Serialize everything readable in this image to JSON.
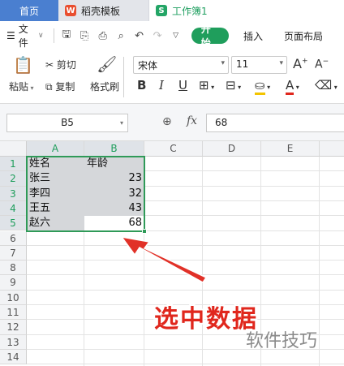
{
  "tabs": [
    {
      "label": "首页"
    },
    {
      "label": "稻壳模板",
      "logo": "W"
    },
    {
      "label": "工作簿1",
      "logo": "S"
    }
  ],
  "menu": {
    "file_label": "文件",
    "start_label": "开始",
    "insert_label": "插入",
    "layout_label": "页面布局"
  },
  "ribbon": {
    "paste_label": "粘贴",
    "cut_label": "剪切",
    "copy_label": "复制",
    "format_painter_label": "格式刷",
    "font_name": "宋体",
    "font_size": "11",
    "bold_glyph": "B",
    "italic_glyph": "I",
    "underline_glyph": "U",
    "grow_glyph": "A",
    "shrink_glyph": "A",
    "fontcolor_glyph": "A"
  },
  "formula": {
    "name_box": "B5",
    "fx_label": "fx",
    "value": "68"
  },
  "sheet": {
    "columns": [
      "A",
      "B",
      "C",
      "D",
      "E"
    ],
    "rows": [
      "1",
      "2",
      "3",
      "4",
      "5",
      "6",
      "7",
      "8",
      "9",
      "10",
      "11",
      "12",
      "13",
      "14"
    ],
    "cells": [
      [
        "姓名",
        "年龄"
      ],
      [
        "张三",
        "23"
      ],
      [
        "李四",
        "32"
      ],
      [
        "王五",
        "43"
      ],
      [
        "赵六",
        "68"
      ]
    ]
  },
  "annotation": "选中数据",
  "watermark": "软件技巧",
  "colors": {
    "accent": "#1f9e5c",
    "selection_border": "#2f9a58",
    "annotation": "#e0271d",
    "home_tab": "#4a7fd0"
  }
}
